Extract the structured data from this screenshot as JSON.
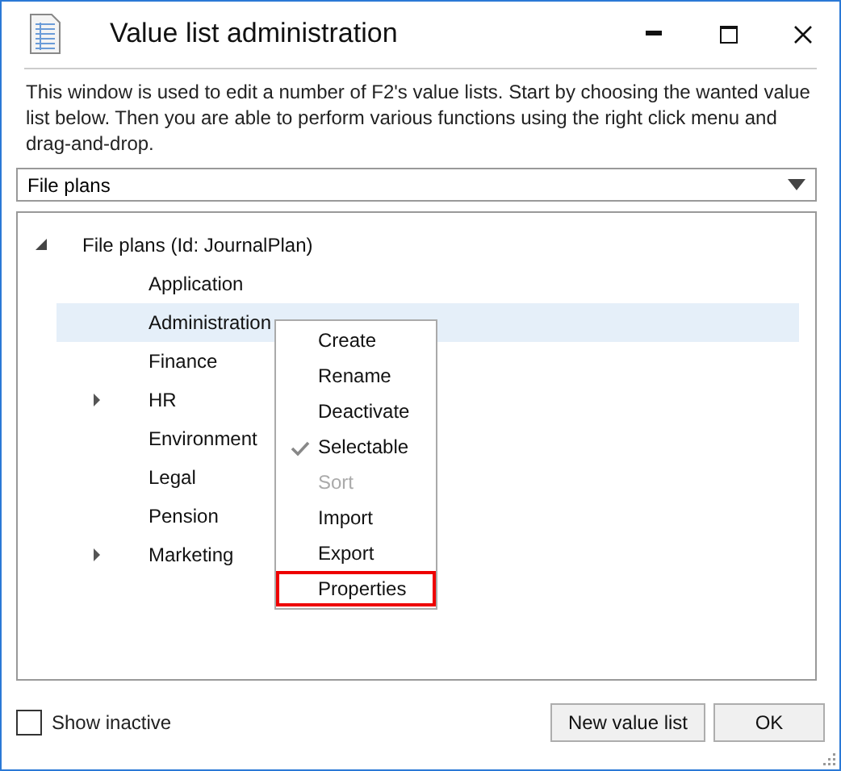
{
  "window": {
    "title": "Value list administration"
  },
  "description": "This window is used to edit a number of F2's value lists. Start by choosing the wanted value list below. Then you are able to perform various functions using the right click menu and drag-and-drop.",
  "value_list_dropdown": {
    "value": "File plans"
  },
  "tree": [
    {
      "label": "File plans (Id: JournalPlan)",
      "kind": "group",
      "expanded": true,
      "selected": false,
      "children": [
        {
          "label": "Application",
          "kind": "leaf",
          "selected": false
        },
        {
          "label": "Administration",
          "kind": "leaf",
          "selected": true
        },
        {
          "label": "Finance",
          "kind": "leaf",
          "selected": false
        },
        {
          "label": "HR",
          "kind": "group",
          "expanded": false,
          "selected": false
        },
        {
          "label": "Environment",
          "kind": "leaf",
          "selected": false
        },
        {
          "label": "Legal",
          "kind": "leaf",
          "selected": false
        },
        {
          "label": "Pension",
          "kind": "leaf",
          "selected": false
        },
        {
          "label": "Marketing",
          "kind": "group",
          "expanded": false,
          "selected": false
        }
      ]
    }
  ],
  "context_menu": [
    {
      "label": "Create",
      "checked": false,
      "disabled": false,
      "outlined": false
    },
    {
      "label": "Rename",
      "checked": false,
      "disabled": false,
      "outlined": false
    },
    {
      "label": "Deactivate",
      "checked": false,
      "disabled": false,
      "outlined": false
    },
    {
      "label": "Selectable",
      "checked": true,
      "disabled": false,
      "outlined": false
    },
    {
      "label": "Sort",
      "checked": false,
      "disabled": true,
      "outlined": false
    },
    {
      "label": "Import",
      "checked": false,
      "disabled": false,
      "outlined": false
    },
    {
      "label": "Export",
      "checked": false,
      "disabled": false,
      "outlined": false
    },
    {
      "label": "Properties",
      "checked": false,
      "disabled": false,
      "outlined": true
    }
  ],
  "show_inactive": {
    "label": "Show inactive",
    "checked": false
  },
  "buttons": [
    "New value list",
    "OK"
  ]
}
